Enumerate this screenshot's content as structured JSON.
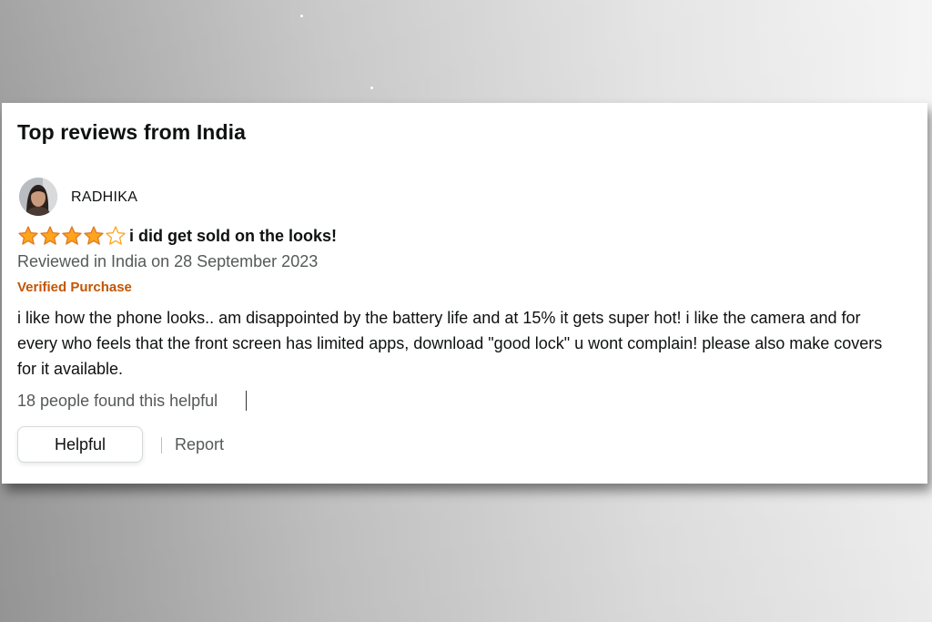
{
  "section_title": "Top reviews from India",
  "review": {
    "reviewer_name": "RADHIKA",
    "avatar_icon": "user-avatar",
    "rating": 4,
    "rating_max": 5,
    "star_color": "#FFA41C",
    "headline": "i did get sold on the looks!",
    "meta": "Reviewed in India on 28 September 2023",
    "verified_label": "Verified Purchase",
    "verified_color": "#C45500",
    "body": "i like how the phone looks.. am disappointed by the battery life and at 15% it gets super hot! i like the camera and for every who feels that the front screen has limited apps, download \"good lock\" u wont complain! please also make covers for it available.",
    "helpful_count_text": "18 people found this helpful"
  },
  "actions": {
    "helpful_label": "Helpful",
    "report_label": "Report"
  }
}
